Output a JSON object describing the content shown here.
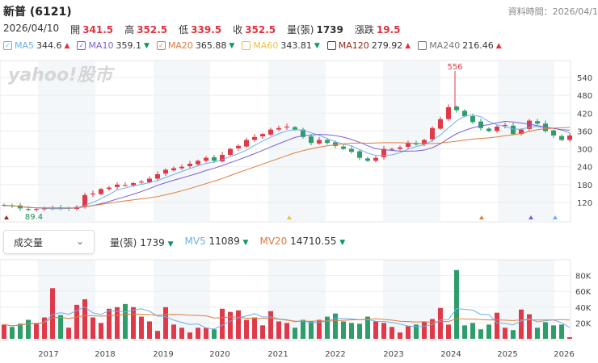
{
  "header": {
    "title": "新普 (6121)",
    "data_time": "資料時間：2026/04/1"
  },
  "ohlc": {
    "date": "2026/04/10",
    "open_label": "開",
    "open": "341.5",
    "high_label": "高",
    "high": "352.5",
    "low_label": "低",
    "low": "339.5",
    "close_label": "收",
    "close": "352.5",
    "vol_label": "量(張)",
    "vol": "1739",
    "chg_label": "漲跌",
    "chg": "19.5"
  },
  "ma_legend": [
    {
      "name": "MA5",
      "value": "344.6",
      "dir": "▲",
      "color": "#6fb0ea",
      "checked": true
    },
    {
      "name": "MA10",
      "value": "359.1",
      "dir": "▼",
      "color": "#7b5fd6",
      "checked": true
    },
    {
      "name": "MA20",
      "value": "365.88",
      "dir": "▼",
      "color": "#e07b3c",
      "checked": true
    },
    {
      "name": "MA60",
      "value": "343.81",
      "dir": "▼",
      "color": "#e8c04a",
      "checked": false
    },
    {
      "name": "MA120",
      "value": "279.92",
      "dir": "▲",
      "color": "#8b2a1a",
      "checked": false
    },
    {
      "name": "MA240",
      "value": "216.46",
      "dir": "▲",
      "color": "#777777",
      "checked": false
    }
  ],
  "indicator_select": {
    "value": "成交量"
  },
  "vol_legend": {
    "vol_label": "量(張)",
    "vol": "1739",
    "mv5_label": "MV5",
    "mv5": "11089",
    "mv20_label": "MV20",
    "mv20": "14710.55",
    "dir": "▼"
  },
  "watermark": "yahoo!股市",
  "colors": {
    "up": "#e0394a",
    "down": "#2e9d6a",
    "mv5": "#6fb0ea",
    "mv20": "#e07b3c"
  },
  "chart_data": {
    "type": "candlestick",
    "price_axis": {
      "ticks": [
        120,
        180,
        240,
        300,
        360,
        420,
        480,
        540
      ],
      "range": [
        80,
        580
      ]
    },
    "volume_axis": {
      "ticks": [
        "20K",
        "40K",
        "60K",
        "80K"
      ],
      "range": [
        0,
        95
      ]
    },
    "x_ticks": [
      "2017",
      "2018",
      "2019",
      "2020",
      "2021",
      "2022",
      "2023",
      "2024",
      "2025",
      "2026"
    ],
    "annotations": {
      "high": "556",
      "low": "89.4"
    },
    "closes": [
      110,
      108,
      100,
      95,
      98,
      100,
      102,
      100,
      100,
      105,
      145,
      150,
      165,
      170,
      180,
      178,
      185,
      190,
      200,
      215,
      230,
      235,
      240,
      250,
      260,
      270,
      260,
      280,
      300,
      310,
      330,
      340,
      350,
      365,
      370,
      375,
      365,
      340,
      320,
      330,
      320,
      310,
      300,
      290,
      270,
      260,
      270,
      300,
      300,
      305,
      320,
      315,
      330,
      370,
      400,
      440,
      430,
      410,
      390,
      370,
      360,
      375,
      380,
      350,
      365,
      395,
      385,
      360,
      345,
      330,
      345
    ],
    "volumes_k": [
      18,
      15,
      19,
      24,
      20,
      27,
      64,
      30,
      14,
      43,
      50,
      27,
      20,
      38,
      40,
      44,
      40,
      28,
      22,
      10,
      40,
      18,
      14,
      8,
      14,
      14,
      12,
      38,
      34,
      36,
      24,
      27,
      17,
      35,
      22,
      20,
      14,
      24,
      22,
      24,
      28,
      32,
      22,
      20,
      19,
      28,
      22,
      20,
      15,
      8,
      16,
      18,
      22,
      25,
      39,
      18,
      87,
      17,
      20,
      12,
      18,
      33,
      14,
      11,
      37,
      31,
      14,
      21,
      17,
      18,
      2
    ]
  }
}
